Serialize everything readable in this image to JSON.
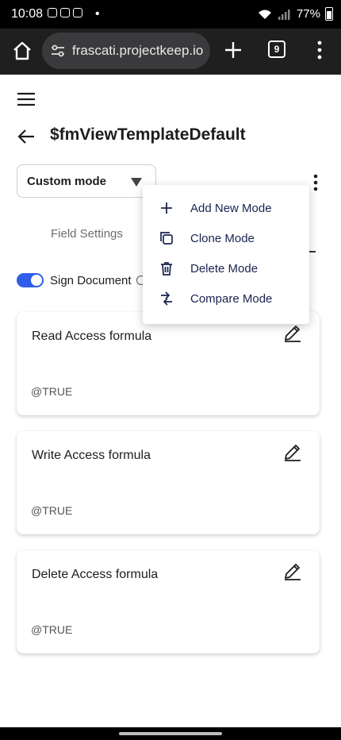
{
  "status_bar": {
    "time": "10:08",
    "dot": "•",
    "battery": "77%"
  },
  "browser": {
    "url": "frascati.projectkeep.io",
    "tab_count": "9"
  },
  "header": {
    "title": "$fmViewTemplateDefault"
  },
  "mode_select": {
    "value": "Custom mode"
  },
  "tabs": {
    "field_settings": "Field Settings"
  },
  "sign_document": {
    "label": "Sign Document",
    "enabled": true
  },
  "menu": {
    "items": [
      {
        "label": "Add New Mode",
        "icon": "plus-icon"
      },
      {
        "label": "Clone Mode",
        "icon": "copy-icon"
      },
      {
        "label": "Delete Mode",
        "icon": "trash-icon"
      },
      {
        "label": "Compare Mode",
        "icon": "compare-icon"
      }
    ]
  },
  "cards": [
    {
      "title": "Read Access formula",
      "value": "@TRUE"
    },
    {
      "title": "Write Access formula",
      "value": "@TRUE"
    },
    {
      "title": "Delete Access formula",
      "value": "@TRUE"
    }
  ],
  "colors": {
    "accent": "#2f5dea",
    "menu_text": "#1a2350",
    "browser_bar": "#1f1f1f"
  }
}
